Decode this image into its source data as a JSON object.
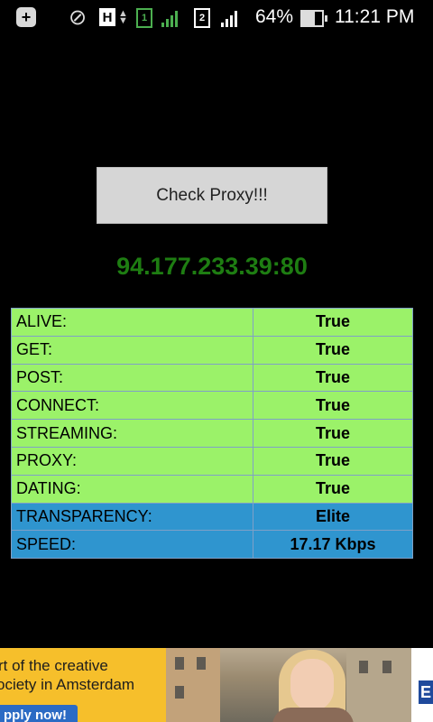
{
  "status_bar": {
    "icons": [
      "notification-plus-icon",
      "mute-icon",
      "h-network-icon",
      "data-arrows-icon",
      "sim1-icon",
      "signal1-icon",
      "sim2-icon",
      "signal2-icon",
      "battery-icon"
    ],
    "network_type": "H",
    "sim1": "1",
    "sim2": "2",
    "battery_percent": "64%",
    "battery_level": 0.64,
    "time": "11:21 PM",
    "colors": {
      "sim1": "#4caf50",
      "text": "#ffffff"
    }
  },
  "main": {
    "check_button_label": "Check Proxy!!!",
    "proxy_address": "94.177.233.39:80",
    "colors": {
      "proxy_address": "#1e7d12",
      "row_ok": "#9bf269",
      "row_info": "#2f95cf"
    }
  },
  "results": [
    {
      "label": "ALIVE:",
      "value": "True"
    },
    {
      "label": "GET:",
      "value": "True"
    },
    {
      "label": "POST:",
      "value": "True"
    },
    {
      "label": "CONNECT:",
      "value": "True"
    },
    {
      "label": "STREAMING:",
      "value": "True"
    },
    {
      "label": "PROXY:",
      "value": "True"
    },
    {
      "label": "DATING:",
      "value": "True"
    },
    {
      "label": "TRANSPARENCY:",
      "value": "Elite"
    },
    {
      "label": "SPEED:",
      "value": "17.17 Kbps"
    }
  ],
  "ad": {
    "line1": "rt of the creative",
    "line2": "ociety in Amsterdam",
    "cta": "pply now!",
    "logo_letter": "E",
    "colors": {
      "background": "#f6bf2b",
      "cta": "#2b6bc4"
    }
  }
}
